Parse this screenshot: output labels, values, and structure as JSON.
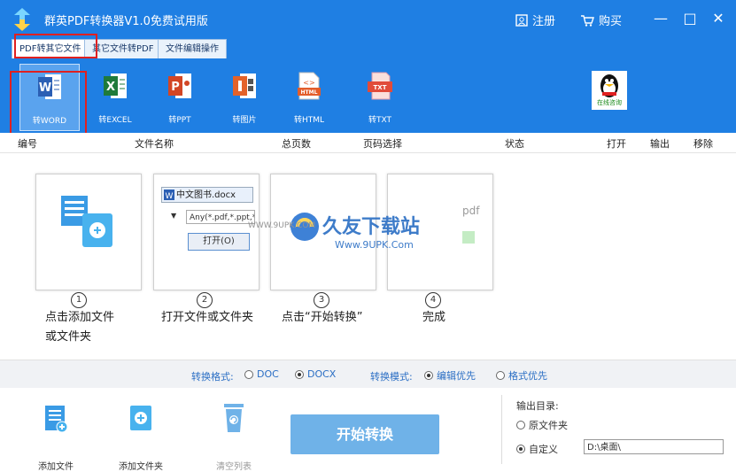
{
  "titlebar": {
    "title": "群英PDF转换器V1.0免费试用版",
    "register": "注册",
    "buy": "购买",
    "minimize": "—",
    "maximize": "□",
    "close": "✕"
  },
  "tabs": [
    {
      "label": "PDF转其它文件"
    },
    {
      "label": "其它文件转PDF"
    },
    {
      "label": "文件编辑操作"
    }
  ],
  "tools": [
    {
      "label": "转WORD",
      "icon": "word-icon",
      "color": "#2b5fb4"
    },
    {
      "label": "转EXCEL",
      "icon": "excel-icon",
      "color": "#1f7a3b"
    },
    {
      "label": "转PPT",
      "icon": "ppt-icon",
      "color": "#d24625"
    },
    {
      "label": "转图片",
      "icon": "image-icon",
      "color": "#e3622a"
    },
    {
      "label": "转HTML",
      "icon": "html-icon",
      "color": "#e35d2b"
    },
    {
      "label": "转TXT",
      "icon": "txt-icon",
      "color": "#e14b3a"
    }
  ],
  "online": {
    "label": "在线咨询"
  },
  "columns": [
    "编号",
    "文件名称",
    "总页数",
    "页码选择",
    "状态",
    "打开",
    "输出",
    "移除"
  ],
  "steps": [
    {
      "num": "1",
      "text1": "点击添加文件",
      "text2": "或文件夹"
    },
    {
      "num": "2",
      "text1": "打开文件或文件夹",
      "text2": ""
    },
    {
      "num": "3",
      "text1": "点击“开始转换”",
      "text2": ""
    },
    {
      "num": "4",
      "text1": "完成",
      "text2": ""
    }
  ],
  "dialog": {
    "filename": "中文图书.docx",
    "filter": "Any(*.pdf,*.ppt,*",
    "open": "打开(O)",
    "pdf": "pdf"
  },
  "watermark": {
    "brand": "久友下载站",
    "url": "Www.9UPK.Com",
    "small": "WWW.9UPK.COM"
  },
  "options": {
    "format_label": "转换格式:",
    "doc": "DOC",
    "docx": "DOCX",
    "mode_label": "转换模式:",
    "edit_first": "编辑优先",
    "format_first": "格式优先"
  },
  "bottom": {
    "add_file": "添加文件",
    "add_folder": "添加文件夹",
    "clear": "清空列表",
    "start": "开始转换"
  },
  "output": {
    "title": "输出目录:",
    "original": "原文件夹",
    "custom": "自定义",
    "path": "D:\\桌面\\"
  }
}
